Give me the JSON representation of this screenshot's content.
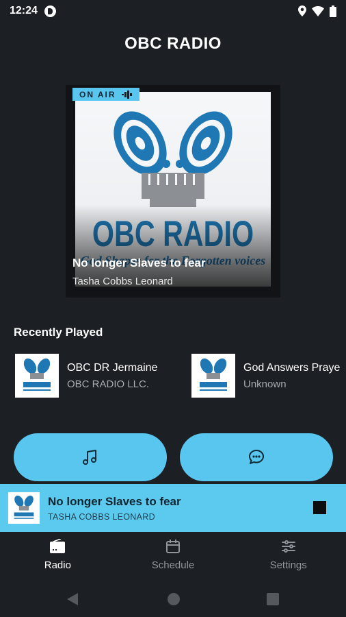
{
  "status_bar": {
    "time": "12:24"
  },
  "app": {
    "title": "OBC RADIO"
  },
  "player": {
    "on_air_label": "ON AIR",
    "artwork_brand": "OBC RADIO",
    "artwork_tagline": "God Shapes for the Forgotten voices",
    "title": "No longer Slaves to fear",
    "artist": "Tasha Cobbs Leonard"
  },
  "recently_played": {
    "title": "Recently Played",
    "items": [
      {
        "name": "OBC DR Jermaine",
        "subtitle": "OBC RADIO LLC."
      },
      {
        "name": "God Answers Praye",
        "subtitle": "Unknown"
      }
    ]
  },
  "actions": {
    "music_icon": "music-note-icon",
    "chat_icon": "chat-bubble-icon"
  },
  "mini_player": {
    "title": "No longer Slaves to fear",
    "artist": "TASHA COBBS LEONARD"
  },
  "bottom_nav": {
    "items": [
      {
        "label": "Radio",
        "icon": "radio-icon",
        "active": true
      },
      {
        "label": "Schedule",
        "icon": "calendar-icon",
        "active": false
      },
      {
        "label": "Settings",
        "icon": "sliders-icon",
        "active": false
      }
    ]
  },
  "colors": {
    "background": "#1c1f23",
    "accent": "#58c6ee",
    "logo_blue": "#1f78b4"
  }
}
